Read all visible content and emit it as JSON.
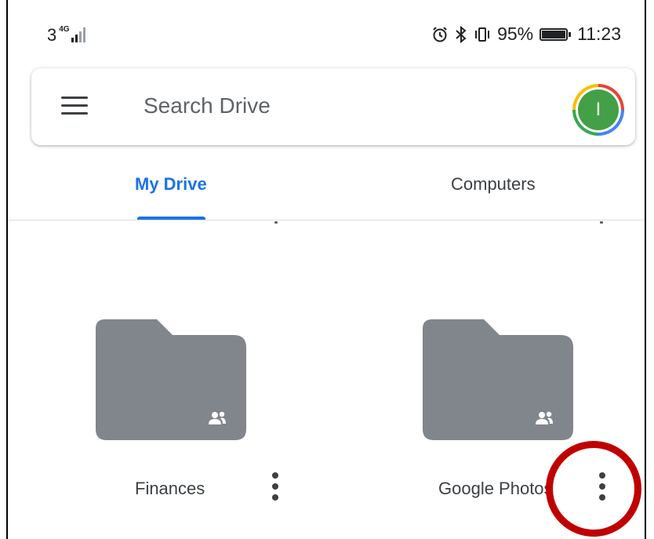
{
  "status_bar": {
    "sim_slot": "3",
    "network": "4G",
    "battery_percent": "95%",
    "time": "11:23",
    "icons": [
      "alarm-icon",
      "bluetooth-icon",
      "vibrate-icon"
    ]
  },
  "search": {
    "placeholder": "Search Drive",
    "avatar_initial": "I"
  },
  "tabs": [
    {
      "label": "My Drive",
      "active": true
    },
    {
      "label": "Computers",
      "active": false
    }
  ],
  "folders": [
    {
      "name": "Finances",
      "shared": true
    },
    {
      "name": "Google Photos",
      "shared": true
    }
  ],
  "colors": {
    "accent": "#1a73e8",
    "folder": "#80868b",
    "avatar": "#43a047",
    "highlight": "#c00000"
  }
}
